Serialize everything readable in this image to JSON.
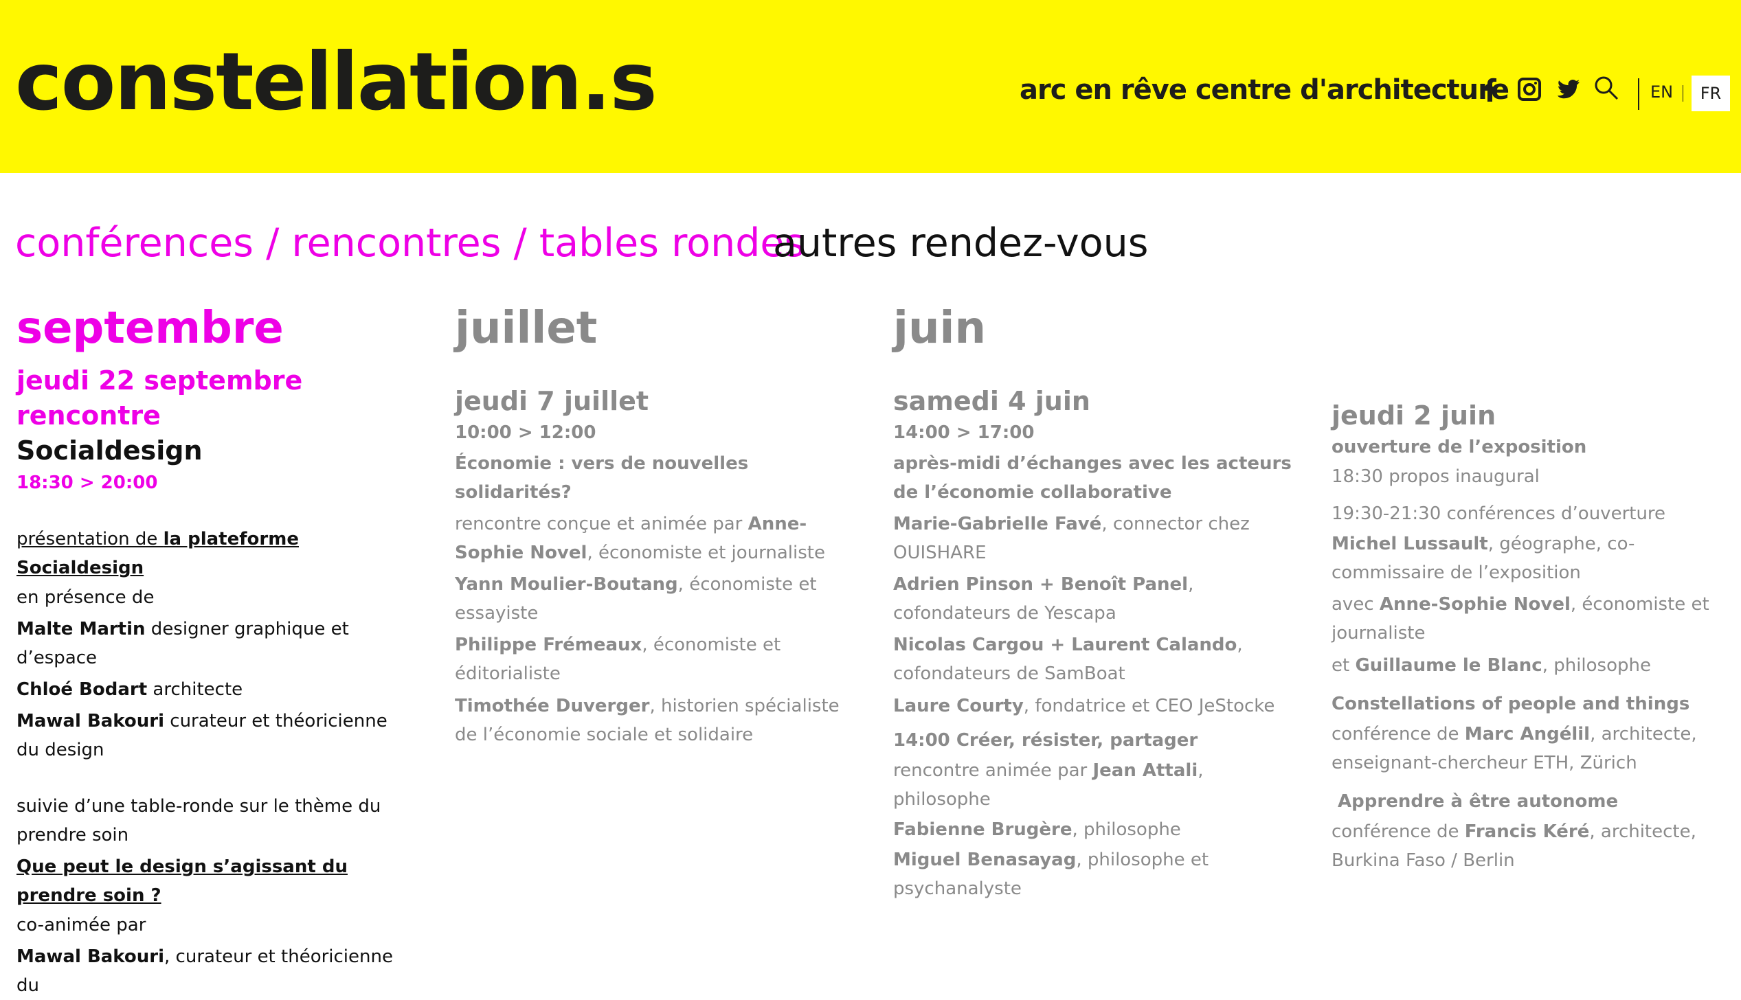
{
  "header": {
    "logo": "constellation.s",
    "org": "arc en rêve  centre d'architecture",
    "social": [
      "facebook-icon",
      "instagram-icon",
      "twitter-icon",
      "search-icon"
    ],
    "lang_en": "EN",
    "lang_fr": "FR"
  },
  "tabs": {
    "active": "conférences / rencontres / tables rondes",
    "other": "autres rendez-vous"
  },
  "colors": {
    "header_bg": "#fff800",
    "accent": "#ee00e6",
    "muted": "#8a8a8a"
  },
  "septembre": {
    "month": "septembre",
    "day": "jeudi 22 septembre",
    "kind": "rencontre",
    "title": "Socialdesign",
    "time": "18:30 > 20:00",
    "intro_a": "présentation de ",
    "intro_b": "la plateforme Socialdesign",
    "presence": "en présence de",
    "p1_name": "Malte Martin",
    "p1_role": " designer graphique et d’espace",
    "p2_name": "Chloé Bodart",
    "p2_role": " architecte",
    "p3_name": "Mawal Bakouri",
    "p3_role": " curateur et théoricienne du design",
    "followed": "suivie d’une table-ronde sur le thème du prendre soin",
    "question": "Que peut le design s’agissant du prendre soin ?",
    "coanimated": "co-animée par",
    "cut_name": "Mawal Bakouri",
    "cut_role": ", curateur et théoricienne du"
  },
  "juillet": {
    "month": "juillet",
    "day": "jeudi 7 juillet",
    "time": "10:00 > 12:00",
    "topic": "Économie : vers de nouvelles solidarités?",
    "conceived": "rencontre conçue et animée par ",
    "host_name": "Anne-Sophie Novel",
    "host_role": ", économiste et journaliste",
    "s1_name": "Yann Moulier-Boutang",
    "s1_role": ", économiste et essayiste",
    "s2_name": "Philippe Frémeaux",
    "s2_role": ", économiste et éditorialiste",
    "s3_name": "Timothée Duverger",
    "s3_role": ", historien spécialiste de l’économie sociale et solidaire"
  },
  "juin": {
    "month": "juin",
    "day": "samedi 4  juin",
    "time": "14:00 > 17:00",
    "topic": "après-midi d’échanges avec les acteurs de l’économie collaborative",
    "s1_name": "Marie-Gabrielle Favé",
    "s1_role": ", connector chez OUISHARE",
    "s2_name": "Adrien Pinson + Benoît Panel",
    "s2_role": ", cofondateurs de Yescapa",
    "s3_name": "Nicolas Cargou + Laurent Calando",
    "s3_role": ", cofondateurs de SamBoat",
    "s4_name": "Laure Courty",
    "s4_role": ", fondatrice et CEO JeStocke",
    "topic2": "14:00 Créer, résister, partager",
    "animated": "rencontre animée par ",
    "h_name": "Jean Attali",
    "h_role": ", philosophe",
    "s5_name": "Fabienne Brugère",
    "s5_role": ", philosophe",
    "s6_name": "Miguel Benasayag",
    "s6_role": ", philosophe et psychanalyste"
  },
  "juin2": {
    "day": "jeudi 2 juin",
    "opening": "ouverture de l’exposition",
    "talk": "18:30 propos inaugural",
    "conf": "19:30-21:30 conférences d’ouverture",
    "m_name": "Michel Lussault",
    "m_role": ", géographe, co-commissaire de l’exposition",
    "avec": "avec ",
    "a_name": "Anne-Sophie Novel",
    "a_role": ", économiste et journaliste",
    "et": "et ",
    "g_name": "Guillaume le Blanc",
    "g_role": ", philosophe",
    "c1_title": "Constellations of people and things",
    "c1_pre": "conférence de ",
    "c1_name": "Marc Angélil",
    "c1_role": ", architecte, enseignant-chercheur ETH, Zürich",
    "c2_title": " Apprendre à être autonome",
    "c2_pre": "conférence de ",
    "c2_name": "Francis Kéré",
    "c2_role": ", architecte, Burkina Faso / Berlin"
  }
}
